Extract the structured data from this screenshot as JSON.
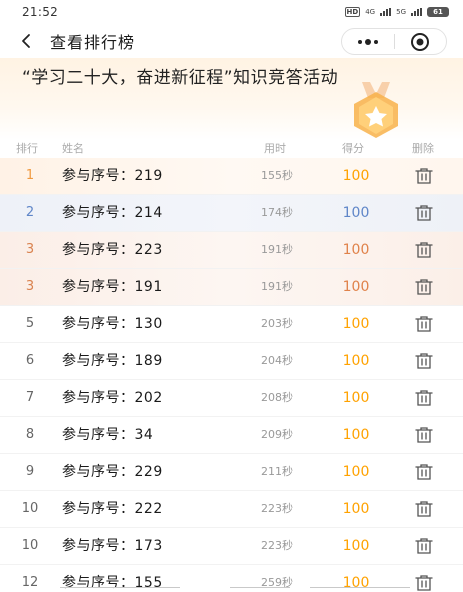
{
  "status_bar": {
    "time": "21:52",
    "hd": "HD",
    "net1": "4G",
    "net2": "5G",
    "battery": "61"
  },
  "nav": {
    "title": "查看排行榜",
    "back_icon": "chevron-left-icon",
    "more_icon": "more-dots-icon",
    "close_icon": "target-close-icon"
  },
  "banner": {
    "title": "“学习二十大，奋进新征程”知识竞答活动",
    "medal_icon": "star-medal-icon"
  },
  "table": {
    "headers": {
      "rank": "排行",
      "name": "姓名",
      "time": "用时",
      "score": "得分",
      "delete": "删除"
    },
    "rows": [
      {
        "rank": "1",
        "name": "参与序号：219",
        "time": "155秒",
        "score": "100",
        "tier": "gold"
      },
      {
        "rank": "2",
        "name": "参与序号：214",
        "time": "174秒",
        "score": "100",
        "tier": "silver"
      },
      {
        "rank": "3",
        "name": "参与序号：223",
        "time": "191秒",
        "score": "100",
        "tier": "bronze"
      },
      {
        "rank": "3",
        "name": "参与序号：191",
        "time": "191秒",
        "score": "100",
        "tier": "bronze"
      },
      {
        "rank": "5",
        "name": "参与序号：130",
        "time": "203秒",
        "score": "100",
        "tier": "normal"
      },
      {
        "rank": "6",
        "name": "参与序号：189",
        "time": "204秒",
        "score": "100",
        "tier": "normal"
      },
      {
        "rank": "7",
        "name": "参与序号：202",
        "time": "208秒",
        "score": "100",
        "tier": "normal"
      },
      {
        "rank": "8",
        "name": "参与序号：34",
        "time": "209秒",
        "score": "100",
        "tier": "normal"
      },
      {
        "rank": "9",
        "name": "参与序号：229",
        "time": "211秒",
        "score": "100",
        "tier": "normal"
      },
      {
        "rank": "10",
        "name": "参与序号：222",
        "time": "223秒",
        "score": "100",
        "tier": "normal"
      },
      {
        "rank": "10",
        "name": "参与序号：173",
        "time": "223秒",
        "score": "100",
        "tier": "normal"
      },
      {
        "rank": "12",
        "name": "参与序号：155",
        "time": "259秒",
        "score": "100",
        "tier": "normal"
      }
    ],
    "delete_icon": "trash-icon"
  },
  "colors": {
    "score": "#ffa200",
    "silver": "#5f86c8",
    "bronze": "#e0824a",
    "gold_rank": "#f09a40"
  }
}
